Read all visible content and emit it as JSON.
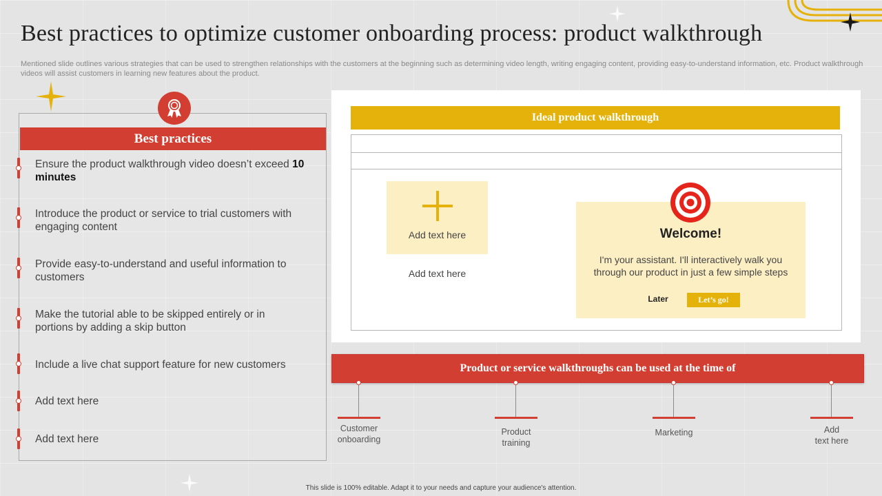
{
  "slide": {
    "title": "Best practices to optimize customer onboarding process: product walkthrough",
    "subtitle": "Mentioned slide outlines various strategies that can be used to strengthen relationships with the customers at the beginning such as determining video length, writing engaging content, providing easy-to-understand information, etc. Product walkthrough videos will assist customers in learning new features about the product.",
    "footer": "This slide is 100% editable. Adapt it to your needs and capture your audience's attention."
  },
  "best_practices": {
    "header": "Best practices",
    "items": [
      {
        "text": "Ensure the product walkthrough  video doesn’t exceed ",
        "bold": "10 minutes"
      },
      {
        "text": "Introduce the product or service to trial customers with engaging content",
        "bold": ""
      },
      {
        "text": "Provide easy-to-understand  and useful information to customers",
        "bold": ""
      },
      {
        "text": "Make the tutorial able to be skipped entirely or in portions by adding a skip button",
        "bold": ""
      },
      {
        "text": "Include  a live chat support feature for new customers",
        "bold": ""
      },
      {
        "text": "Add text here",
        "bold": ""
      },
      {
        "text": "Add text here",
        "bold": ""
      }
    ]
  },
  "ideal_walkthrough": {
    "header": "Ideal product walkthrough",
    "tile_text": "Add text here",
    "below_tile_text": "Add text here",
    "welcome_title": "Welcome!",
    "welcome_message": "I'm your assistant. I'll interactively walk you through our product in just a few simple steps",
    "later_label": "Later",
    "letsgo_label": "Let’s go!"
  },
  "walkthrough_usage": {
    "header": "Product or service walkthroughs can be used at the time of",
    "items": [
      {
        "line1": "Customer",
        "line2": "onboarding"
      },
      {
        "line1": "Product",
        "line2": "training"
      },
      {
        "line1": "Marketing",
        "line2": ""
      },
      {
        "line1": "Add",
        "line2": "text here"
      }
    ]
  },
  "colors": {
    "red": "#d23f32",
    "gold": "#e5b20b",
    "cream": "#fdefc4"
  },
  "icons": {
    "badge": "award-ribbon-icon",
    "tile": "plus-icon",
    "welcome": "target-icon",
    "decor": "sparkle-star-icon"
  }
}
